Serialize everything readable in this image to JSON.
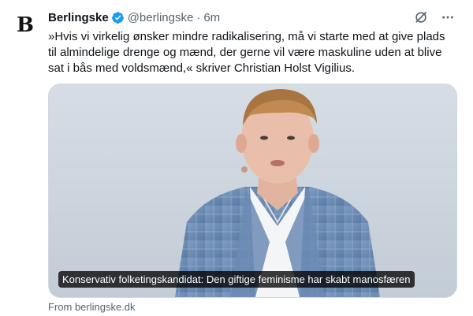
{
  "account": {
    "logo_letter": "B",
    "display_name": "Berlingske",
    "handle": "@berlingske",
    "separator": "·",
    "time": "6m",
    "verified_color": "#1d9bf0"
  },
  "header_icons": [
    "grok-icon",
    "more-icon"
  ],
  "tweet": {
    "text": "»Hvis vi virkelig ønsker mindre radikalisering, må vi starte med at give plads\ntil almindelige drenge og mænd, der gerne vil være maskuline uden at blive\nsat i bås med voldsmænd,« skriver Christian Holst Vigilius."
  },
  "card": {
    "caption": "Konservativ folketingskandidat: Den giftige feminisme har skabt manosfæren",
    "source": "From berlingske.dk"
  },
  "colors": {
    "text": "#0f1419",
    "muted": "#536471",
    "border": "#cfd9de",
    "caption_bg": "#000000"
  }
}
